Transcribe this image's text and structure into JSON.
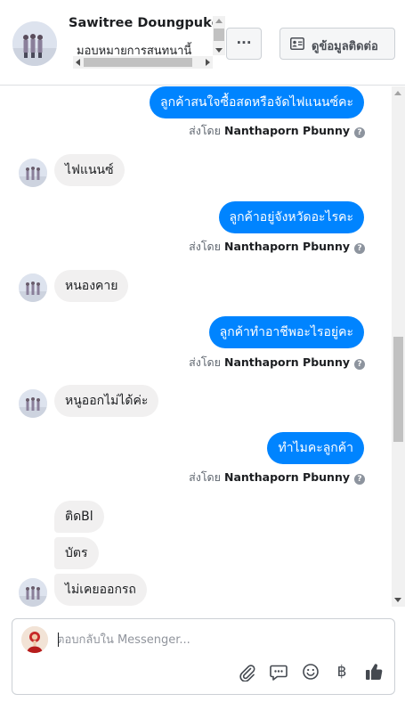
{
  "header": {
    "contact_name": "Sawitree Doungpukdee",
    "subtitle": "มอบหมายการสนทนานี้",
    "more_label": "···",
    "contact_info_label": "ดูข้อมูลติดต่อ"
  },
  "messages": [
    {
      "side": "out",
      "text": "ลูกค้าสนใจซื้อสดหรือจัดไฟแนนซ์คะ",
      "sent_by_prefix": "ส่งโดย",
      "sent_by": "Nanthaporn Pbunny"
    },
    {
      "side": "in",
      "text": "ไฟแนนซ์"
    },
    {
      "side": "out",
      "text": "ลูกค้าอยู่จังหวัดอะไรคะ",
      "sent_by_prefix": "ส่งโดย",
      "sent_by": "Nanthaporn Pbunny"
    },
    {
      "side": "in",
      "text": "หนองคาย"
    },
    {
      "side": "out",
      "text": "ลูกค้าทำอาชีพอะไรอยู่คะ",
      "sent_by_prefix": "ส่งโดย",
      "sent_by": "Nanthaporn Pbunny"
    },
    {
      "side": "in",
      "text": "หนูออกไม่ได้ค่ะ"
    },
    {
      "side": "out",
      "text": "ทำไมคะลูกค้า",
      "sent_by_prefix": "ส่งโดย",
      "sent_by": "Nanthaporn Pbunny"
    },
    {
      "side": "in",
      "text": "ติดBl"
    },
    {
      "side": "in",
      "text": "บัตร"
    },
    {
      "side": "in",
      "text": "ไม่เคยออกรถ"
    }
  ],
  "composer": {
    "placeholder": "ตอบกลับใน Messenger...",
    "tools": [
      "paperclip-icon",
      "saved-reply-icon",
      "emoji-icon",
      "baht-payment-icon",
      "thumbs-up-icon"
    ],
    "baht_symbol": "฿"
  },
  "colors": {
    "outgoing_bubble": "#0084ff",
    "incoming_bubble": "#f1f0f0",
    "like_icon": "#444950"
  }
}
